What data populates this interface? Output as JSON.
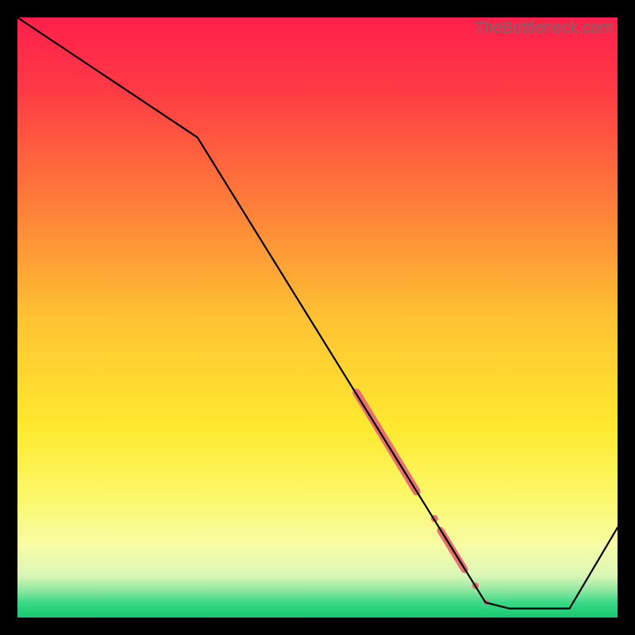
{
  "watermark": {
    "text": "TheBottleneck.com"
  },
  "chart_data": {
    "type": "line",
    "title": "",
    "xlabel": "",
    "ylabel": "",
    "xlim": [
      0,
      100
    ],
    "ylim": [
      0,
      100
    ],
    "grid": false,
    "legend": false,
    "series": [
      {
        "name": "curve",
        "x": [
          0,
          12,
          30,
          78,
          82,
          92,
          100
        ],
        "y": [
          100,
          92,
          80,
          2.5,
          1.5,
          1.5,
          15
        ],
        "stroke": "#000000",
        "width": 2.2
      }
    ],
    "highlights": [
      {
        "name": "segment-1",
        "x1": 56.5,
        "y1": 37.5,
        "x2": 66.5,
        "y2": 21,
        "color": "#e76f6f",
        "width": 10
      },
      {
        "name": "dot-1",
        "cx": 69.5,
        "cy": 16.5,
        "r": 4.5,
        "color": "#e76f6f"
      },
      {
        "name": "segment-2",
        "x1": 70.5,
        "y1": 14.5,
        "x2": 74.5,
        "y2": 8,
        "color": "#e76f6f",
        "width": 9
      },
      {
        "name": "dot-2",
        "cx": 76.3,
        "cy": 5.3,
        "r": 4.2,
        "color": "#e76f6f"
      },
      {
        "name": "dot-3",
        "cx": 78.2,
        "cy": 2.5,
        "r": 3.2,
        "color": "#e76f6f"
      }
    ],
    "background_gradient": {
      "stops": [
        {
          "offset": 0.0,
          "color": "#ff1f4b"
        },
        {
          "offset": 0.12,
          "color": "#ff3a45"
        },
        {
          "offset": 0.3,
          "color": "#ff7a3a"
        },
        {
          "offset": 0.5,
          "color": "#ffc233"
        },
        {
          "offset": 0.68,
          "color": "#ffe92e"
        },
        {
          "offset": 0.8,
          "color": "#fbf86a"
        },
        {
          "offset": 0.88,
          "color": "#f8fca6"
        },
        {
          "offset": 0.93,
          "color": "#d9f6b6"
        },
        {
          "offset": 0.955,
          "color": "#8ee8a0"
        },
        {
          "offset": 0.975,
          "color": "#3bd987"
        },
        {
          "offset": 1.0,
          "color": "#16c971"
        }
      ]
    }
  }
}
